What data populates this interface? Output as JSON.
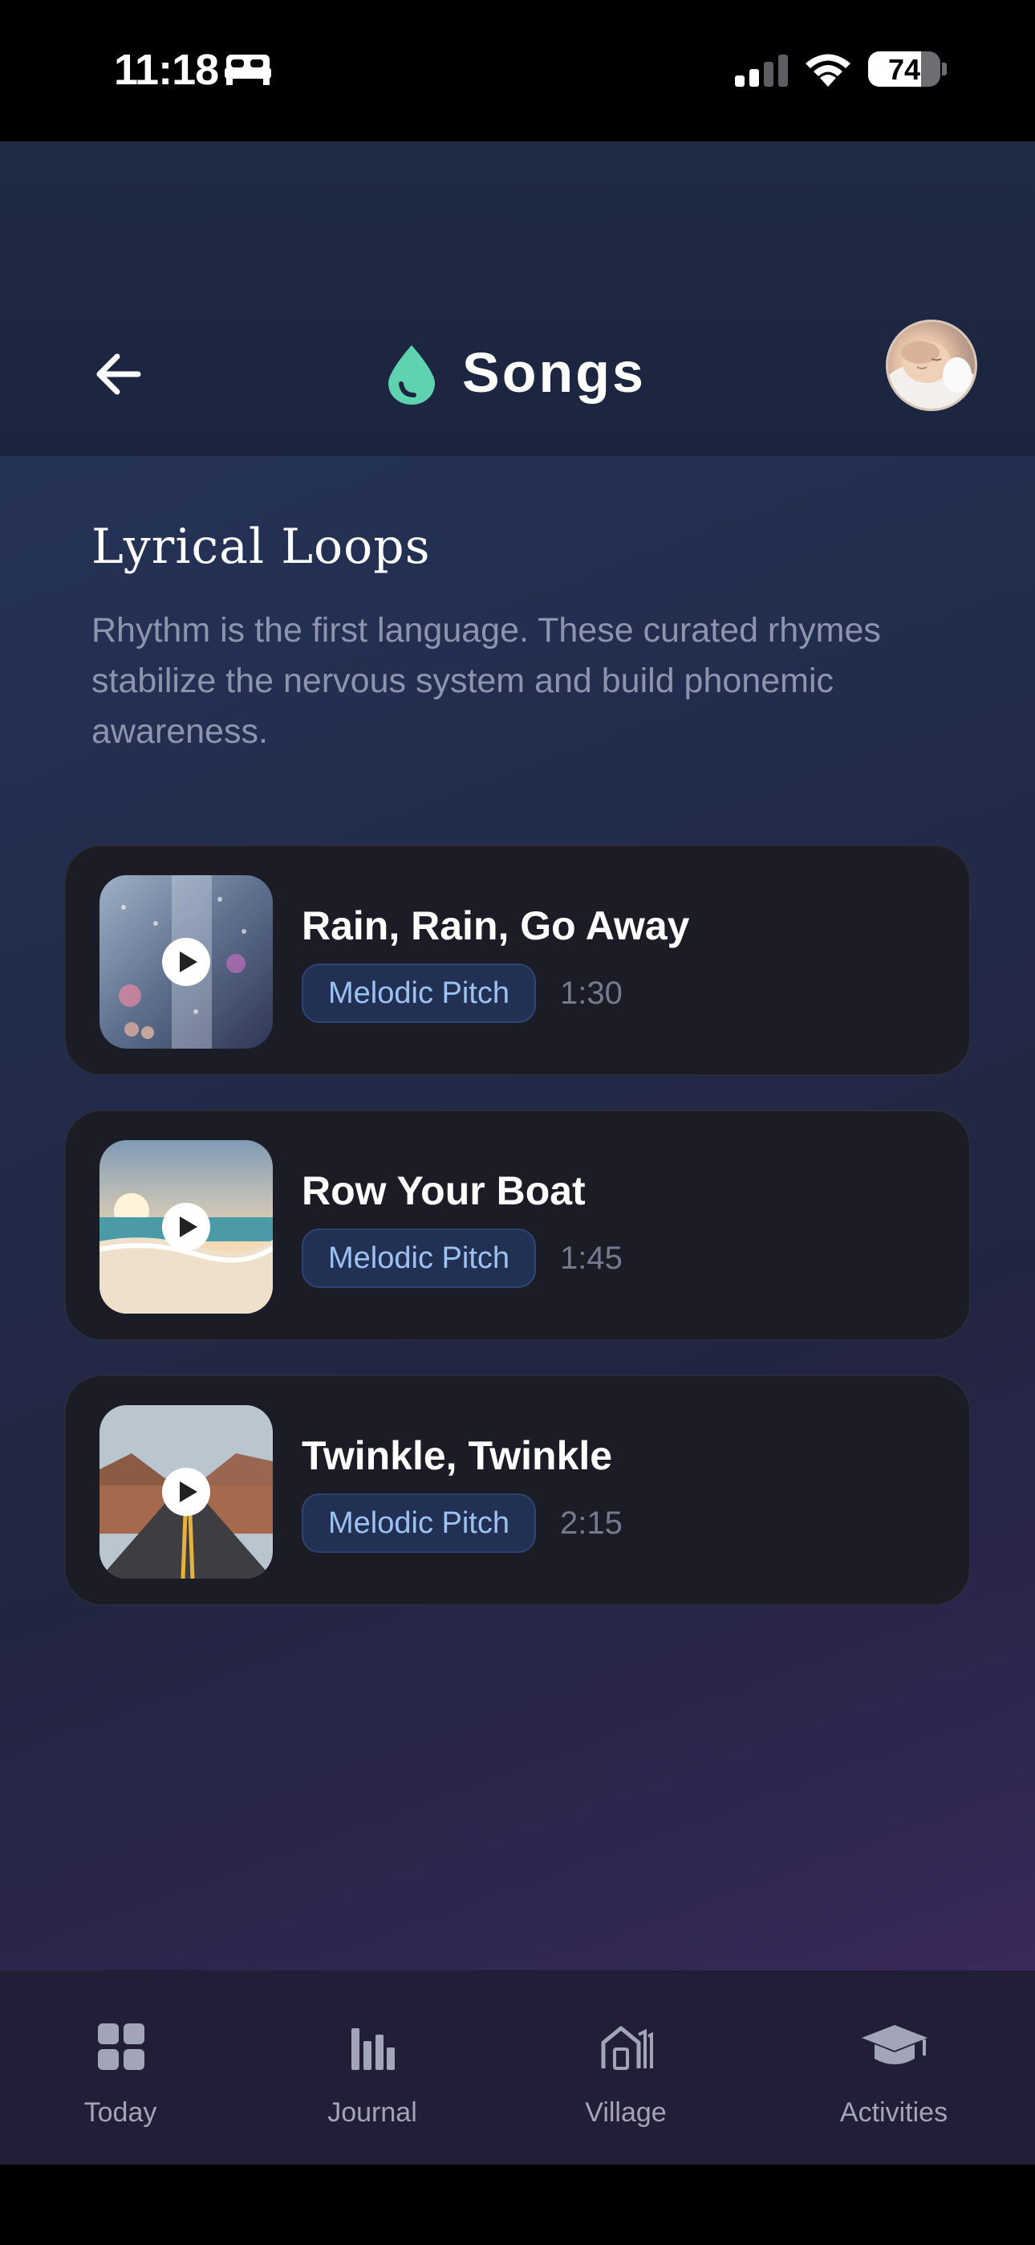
{
  "status_bar": {
    "time": "11:18",
    "battery": "74"
  },
  "header": {
    "title": "Songs"
  },
  "section": {
    "title": "Lyrical Loops",
    "description": "Rhythm is the first language. These curated rhymes stabilize the nervous system and build phonemic awareness."
  },
  "songs": [
    {
      "title": "Rain, Rain, Go Away",
      "tag": "Melodic Pitch",
      "duration": "1:30"
    },
    {
      "title": "Row Your Boat",
      "tag": "Melodic Pitch",
      "duration": "1:45"
    },
    {
      "title": "Twinkle, Twinkle",
      "tag": "Melodic Pitch",
      "duration": "2:15"
    }
  ],
  "nav": {
    "items": [
      {
        "label": "Today",
        "icon": "grid-icon"
      },
      {
        "label": "Journal",
        "icon": "bar-chart-icon"
      },
      {
        "label": "Village",
        "icon": "house-icon"
      },
      {
        "label": "Activities",
        "icon": "graduation-cap-icon"
      }
    ]
  },
  "colors": {
    "accent": "#5fd3b0",
    "tag_text": "#9cc2f2",
    "nav_icon": "#a2a4b8"
  }
}
